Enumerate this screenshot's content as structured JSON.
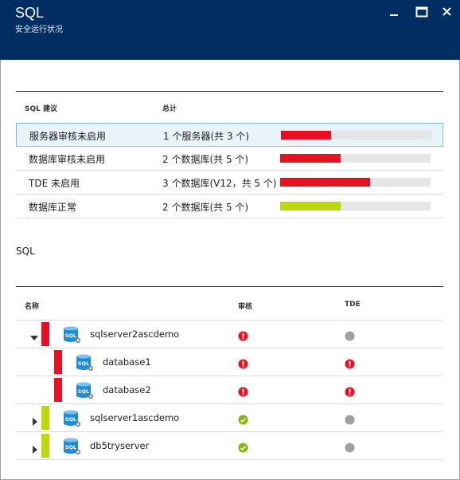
{
  "window": {
    "title": "SQL",
    "subtitle": "安全运行状况"
  },
  "colors": {
    "header_bg": "#002d62",
    "critical": "#e81123",
    "healthy": "#bad80a",
    "healthy_icon": "#7fba00",
    "neutral": "#a0a0a0"
  },
  "recommendations": {
    "headers": {
      "name": "SQL 建议",
      "total": "总计"
    },
    "rows": [
      {
        "name": "服务器审核未启用",
        "total": "1 个服务器(共 3 个)",
        "fraction": 0.333,
        "status": "critical"
      },
      {
        "name": "数据库审核未启用",
        "total": "2 个数据库(共 5 个)",
        "fraction": 0.4,
        "status": "critical"
      },
      {
        "name": "TDE 未启用",
        "total": "3 个数据库(V12，共 5 个)",
        "fraction": 0.6,
        "status": "critical"
      },
      {
        "name": "数据库正常",
        "total": "2 个数据库(共 5 个)",
        "fraction": 0.4,
        "status": "healthy"
      }
    ]
  },
  "servers": {
    "section_title": "SQL",
    "headers": {
      "name": "名称",
      "audit": "审核",
      "tde": "TDE"
    },
    "rows": [
      {
        "name": "sqlserver2ascdemo",
        "level": 0,
        "expander": "expanded",
        "status": "critical",
        "audit": "error",
        "tde": "neutral"
      },
      {
        "name": "database1",
        "level": 1,
        "expander": "none",
        "status": "critical",
        "audit": "error",
        "tde": "error"
      },
      {
        "name": "database2",
        "level": 1,
        "expander": "none",
        "status": "critical",
        "audit": "error",
        "tde": "error"
      },
      {
        "name": "sqlserver1ascdemo",
        "level": 0,
        "expander": "collapsed",
        "status": "healthy",
        "audit": "ok",
        "tde": "neutral"
      },
      {
        "name": "db5tryserver",
        "level": 0,
        "expander": "collapsed",
        "status": "healthy",
        "audit": "ok",
        "tde": "neutral"
      }
    ],
    "db_icon_label": "SQL"
  }
}
